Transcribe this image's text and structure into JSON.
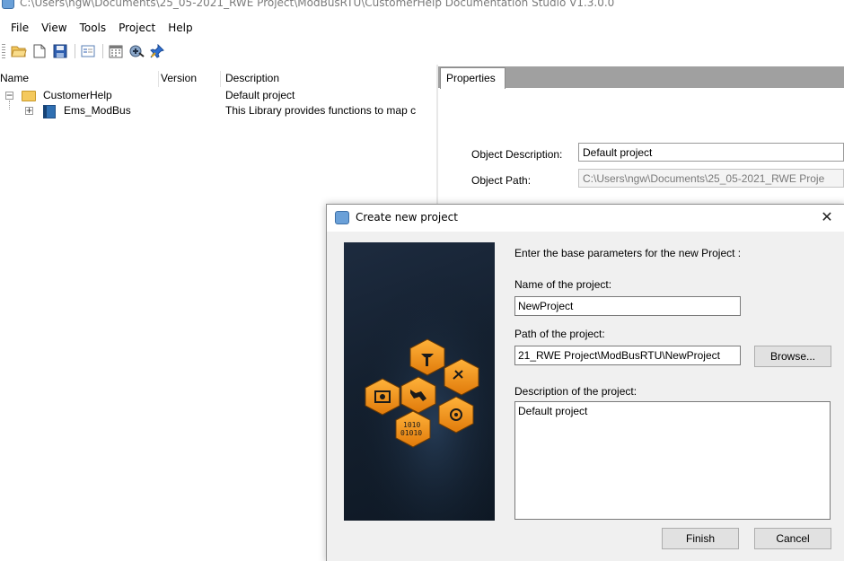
{
  "window": {
    "title": "C:\\Users\\ngw\\Documents\\25_05-2021_RWE Project\\ModBusRTU\\CustomerHelp Documentation Studio V1.3.0.0"
  },
  "menu": {
    "items": [
      "File",
      "View",
      "Tools",
      "Project",
      "Help"
    ]
  },
  "toolbar": {
    "icons": [
      "open-folder-icon",
      "new-document-icon",
      "save-icon",
      "properties-list-icon",
      "calendar-icon",
      "build-icon",
      "pin-icon"
    ]
  },
  "tree": {
    "columns": {
      "name": "Name",
      "version": "Version",
      "description": "Description"
    },
    "rows": [
      {
        "name": "CustomerHelp",
        "version": "",
        "description": "Default project"
      },
      {
        "name": "Ems_ModBus",
        "version": "",
        "description": "This Library provides functions to map c"
      }
    ]
  },
  "properties": {
    "tab_label": "Properties",
    "object_description_label": "Object Description:",
    "object_description_value": "Default project",
    "object_path_label": "Object Path:",
    "object_path_value": "C:\\Users\\ngw\\Documents\\25_05-2021_RWE Proje"
  },
  "dialog": {
    "title": "Create new project",
    "intro": "Enter the base parameters for the new Project :",
    "name_label": "Name of the project:",
    "name_value": "NewProject",
    "path_label": "Path of the project:",
    "path_value": "21_RWE Project\\ModBusRTU\\NewProject",
    "browse_label": "Browse...",
    "description_label": "Description of the project:",
    "description_value": "Default project",
    "finish_label": "Finish",
    "cancel_label": "Cancel",
    "close_glyph": "✕"
  },
  "colors": {
    "tabbar_gray": "#a0a0a0",
    "dialog_bg": "#f0f0f0",
    "hexagon_orange": "#f29a1d",
    "image_dark_blue": "#14202f"
  }
}
